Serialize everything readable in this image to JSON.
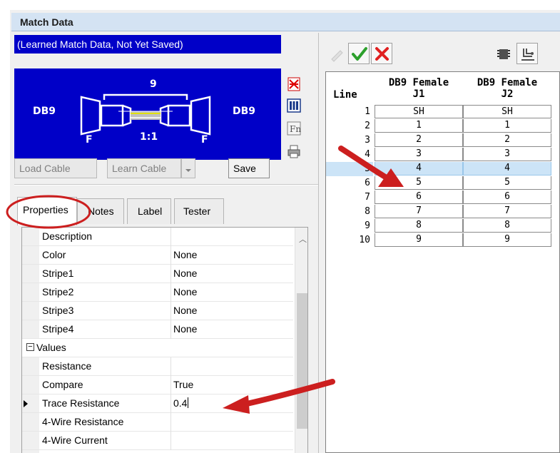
{
  "window": {
    "title": "Match Data"
  },
  "left": {
    "status_text": "(Learned Match Data, Not Yet Saved)",
    "cable": {
      "left_connector": "DB9",
      "right_connector": "DB9",
      "left_gender": "F",
      "right_gender": "F",
      "wire_count": "9",
      "ratio": "1:1"
    },
    "side_icons": [
      "compare-icon",
      "list-view-icon",
      "function-icon",
      "print-icon"
    ],
    "buttons": {
      "load_cable": "Load Cable",
      "learn_cable": "Learn Cable",
      "save": "Save"
    },
    "tabs": [
      {
        "label": "Properties"
      },
      {
        "label": "Notes"
      },
      {
        "label": "Label"
      },
      {
        "label": "Tester"
      }
    ],
    "properties": {
      "rows": [
        {
          "name": "Description",
          "value": ""
        },
        {
          "name": "Color",
          "value": "None"
        },
        {
          "name": "Stripe1",
          "value": "None"
        },
        {
          "name": "Stripe2",
          "value": "None"
        },
        {
          "name": "Stripe3",
          "value": "None"
        },
        {
          "name": "Stripe4",
          "value": "None"
        }
      ],
      "values_category": "Values",
      "value_rows": [
        {
          "name": "Resistance",
          "value": ""
        },
        {
          "name": "Compare",
          "value": "True"
        },
        {
          "name": "Trace Resistance",
          "value": "0.4"
        },
        {
          "name": "4-Wire Resistance",
          "value": ""
        },
        {
          "name": "4-Wire Current",
          "value": ""
        }
      ]
    }
  },
  "right": {
    "toolbar": [
      "edit-icon",
      "accept-icon",
      "reject-icon",
      "connector-icon",
      "wiring-icon"
    ],
    "grid": {
      "headers": {
        "line": "Line",
        "j1_title": "DB9 Female",
        "j1_sub": "J1",
        "j2_title": "DB9 Female",
        "j2_sub": "J2"
      },
      "rows": [
        {
          "line": "1",
          "j1": "SH",
          "j2": "SH"
        },
        {
          "line": "2",
          "j1": "1",
          "j2": "1"
        },
        {
          "line": "3",
          "j1": "2",
          "j2": "2"
        },
        {
          "line": "4",
          "j1": "3",
          "j2": "3"
        },
        {
          "line": "5",
          "j1": "4",
          "j2": "4"
        },
        {
          "line": "6",
          "j1": "5",
          "j2": "5"
        },
        {
          "line": "7",
          "j1": "6",
          "j2": "6"
        },
        {
          "line": "8",
          "j1": "7",
          "j2": "7"
        },
        {
          "line": "9",
          "j1": "8",
          "j2": "8"
        },
        {
          "line": "10",
          "j1": "9",
          "j2": "9"
        }
      ],
      "selected_line": "5"
    }
  },
  "colors": {
    "panel_blue": "#0000c8",
    "annotation_red": "#cc1f1f",
    "selection": "#cce4f7"
  }
}
